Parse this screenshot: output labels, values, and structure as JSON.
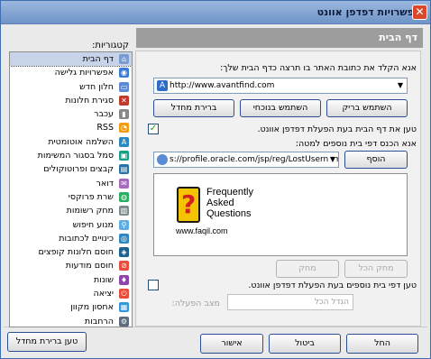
{
  "window": {
    "title": "אפשרויות דפדפן אוונט",
    "close_glyph": "✕"
  },
  "categories": {
    "label": "קטגוריות:",
    "items": [
      {
        "label": "דף הבית",
        "icon": "home-icon",
        "color": "#7a9bd0",
        "glyph": "⌂",
        "selected": true
      },
      {
        "label": "אפשרויות גלישה",
        "icon": "browse-icon",
        "color": "#3a7bd5",
        "glyph": "◉"
      },
      {
        "label": "חלון חדש",
        "icon": "window-icon",
        "color": "#5c8ad6",
        "glyph": "▭"
      },
      {
        "label": "סגירת חלונות",
        "icon": "close-windows-icon",
        "color": "#c0392b",
        "glyph": "✕"
      },
      {
        "label": "עכבר",
        "icon": "mouse-icon",
        "color": "#888888",
        "glyph": "▮"
      },
      {
        "label": "RSS",
        "icon": "rss-icon",
        "color": "#f39c12",
        "glyph": "◔"
      },
      {
        "label": "השלמה אוטומטית",
        "icon": "autocomplete-icon",
        "color": "#2e86c1",
        "glyph": "A"
      },
      {
        "label": "סמל בסגור המשימות",
        "icon": "tray-icon",
        "color": "#16a085",
        "glyph": "▣"
      },
      {
        "label": "קבצים ופרוטוקולים",
        "icon": "files-icon",
        "color": "#2874a6",
        "glyph": "▤"
      },
      {
        "label": "דואר",
        "icon": "mail-icon",
        "color": "#a569bd",
        "glyph": "✉"
      },
      {
        "label": "שרת פרוקסי",
        "icon": "proxy-icon",
        "color": "#27ae60",
        "glyph": "◍"
      },
      {
        "label": "מחק רשומות",
        "icon": "erase-icon",
        "color": "#7f8c8d",
        "glyph": "▥"
      },
      {
        "label": "מנוע חיפוש",
        "icon": "search-engine-icon",
        "color": "#5dade2",
        "glyph": "⚲"
      },
      {
        "label": "כינויים לכתובות",
        "icon": "alias-icon",
        "color": "#2e86c1",
        "glyph": "◎"
      },
      {
        "label": "חוסם חלונות קופצים",
        "icon": "popup-blocker-icon",
        "color": "#1f618d",
        "glyph": "◈"
      },
      {
        "label": "חוסם מודעות",
        "icon": "ad-blocker-icon",
        "color": "#e74c3c",
        "glyph": "⊘"
      },
      {
        "label": "שונות",
        "icon": "misc-icon",
        "color": "#8e44ad",
        "glyph": "♦"
      },
      {
        "label": "יציאה",
        "icon": "exit-icon",
        "color": "#e74c3c",
        "glyph": "⏻"
      },
      {
        "label": "אחסון מקוון",
        "icon": "online-storage-icon",
        "color": "#3498db",
        "glyph": "▦"
      },
      {
        "label": "הרחבות",
        "icon": "extensions-icon",
        "color": "#5d6d7e",
        "glyph": "⚙"
      }
    ]
  },
  "panel": {
    "title": "דף הבית",
    "homepage_label": "אנא הקלד את כתובת האתר בו תרצה כדף הבית שלך:",
    "homepage_value": "http://www.avantfind.com",
    "use_blank_button": "השתמש בריק",
    "use_current_button": "השתמש בנוכחי",
    "use_default_button": "ברירת מחדל",
    "load_home_label": "טען את דף הבית בעת הפעלת דפדפן אוונט.",
    "load_home_checked": true,
    "extra_pages_label": "אנא הכנס דפי בית נוספים למטה:",
    "extra_page_value": "s://profile.oracle.com/jsp/reg/LostUsername",
    "add_button": "הוסף",
    "faq_line1": "Frequently",
    "faq_line2": "Asked",
    "faq_line3": "Questions",
    "faq_url": "www.faqil.com",
    "delete_all_button": "מחק הכל",
    "delete_button": "מחק",
    "load_extra_label": "טען דפי בית נוספים בעת הפעלת דפדפן אוונט.",
    "load_extra_checked": false,
    "startup_state_label": "מצב הפעלה:",
    "startup_state_value": "הגדל הכל"
  },
  "footer": {
    "load_defaults": "טען ברירת מחדל",
    "apply": "החל",
    "cancel": "ביטול",
    "ok": "אישור"
  }
}
